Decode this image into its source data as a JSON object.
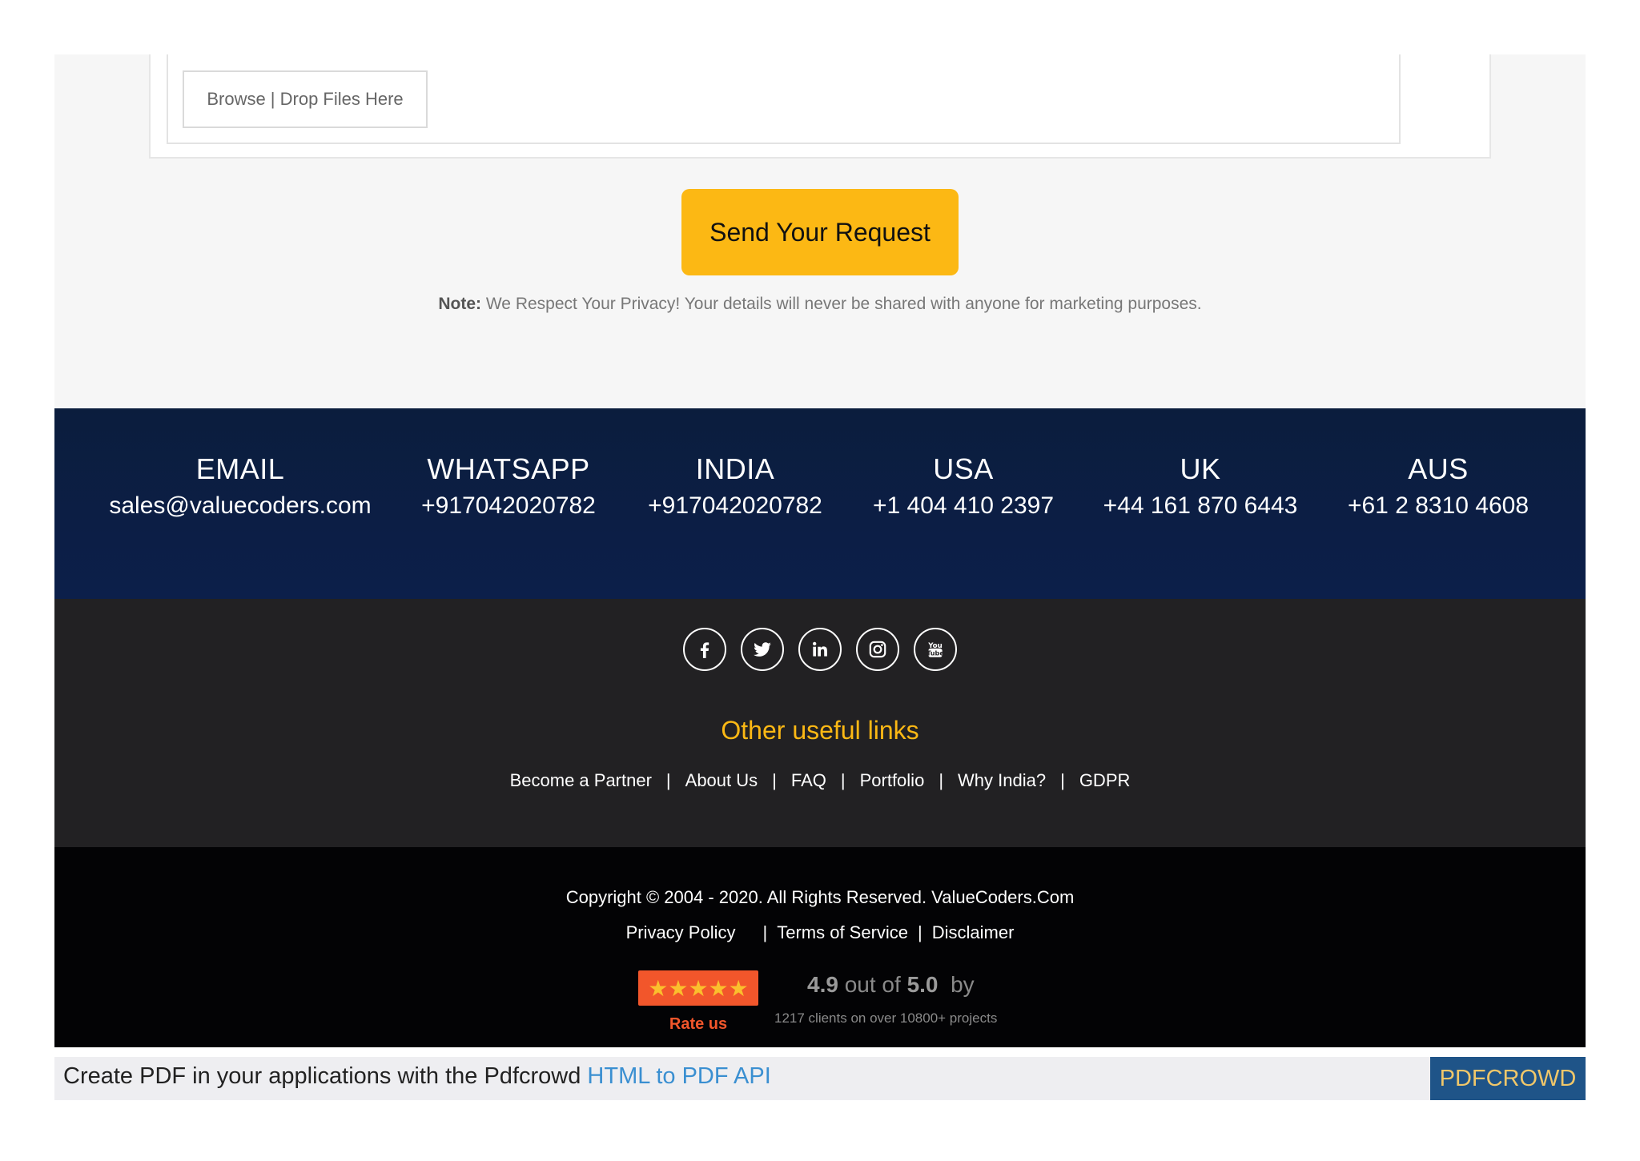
{
  "form": {
    "browse_label": "Browse | Drop Files Here",
    "send_button": "Send Your Request",
    "note_label": "Note:",
    "note_text": " We Respect Your Privacy! Your details will never be shared with anyone for marketing purposes."
  },
  "contacts": [
    {
      "label": "EMAIL",
      "value": "sales@valuecoders.com"
    },
    {
      "label": "WHATSAPP",
      "value": "+917042020782"
    },
    {
      "label": "INDIA",
      "value": "+917042020782"
    },
    {
      "label": "USA",
      "value": "+1 404 410 2397"
    },
    {
      "label": "UK",
      "value": "+44 161 870 6443"
    },
    {
      "label": "AUS",
      "value": "+61 2 8310 4608"
    }
  ],
  "social_icons": [
    "facebook-icon",
    "twitter-icon",
    "linkedin-icon",
    "instagram-icon",
    "youtube-icon"
  ],
  "useful_links": {
    "title": "Other useful links",
    "items": [
      "Become a Partner",
      "About Us",
      "FAQ",
      "Portfolio",
      "Why India?",
      "GDPR"
    ],
    "separator": "|"
  },
  "footer": {
    "copyright": "Copyright © 2004 - 2020. All Rights Reserved. ValueCoders.Com",
    "legal": [
      "Privacy Policy",
      "Terms of Service",
      "Disclaimer"
    ],
    "stars": "★★★★★",
    "rate_us": "Rate us",
    "score": "4.9",
    "out_of": "out of",
    "max": "5.0",
    "by": "by",
    "clients": "1217 clients on over 10800+ projects"
  },
  "pdfcrowd": {
    "text": "Create PDF in your applications with the Pdfcrowd ",
    "link": "HTML to PDF API",
    "brand": "PDFCROWD"
  },
  "colors": {
    "accent_yellow": "#fcb814",
    "navy": "#0c1f4a",
    "dark": "#222123",
    "rate_orange": "#f2562b",
    "pdf_blue": "#1f5488"
  }
}
